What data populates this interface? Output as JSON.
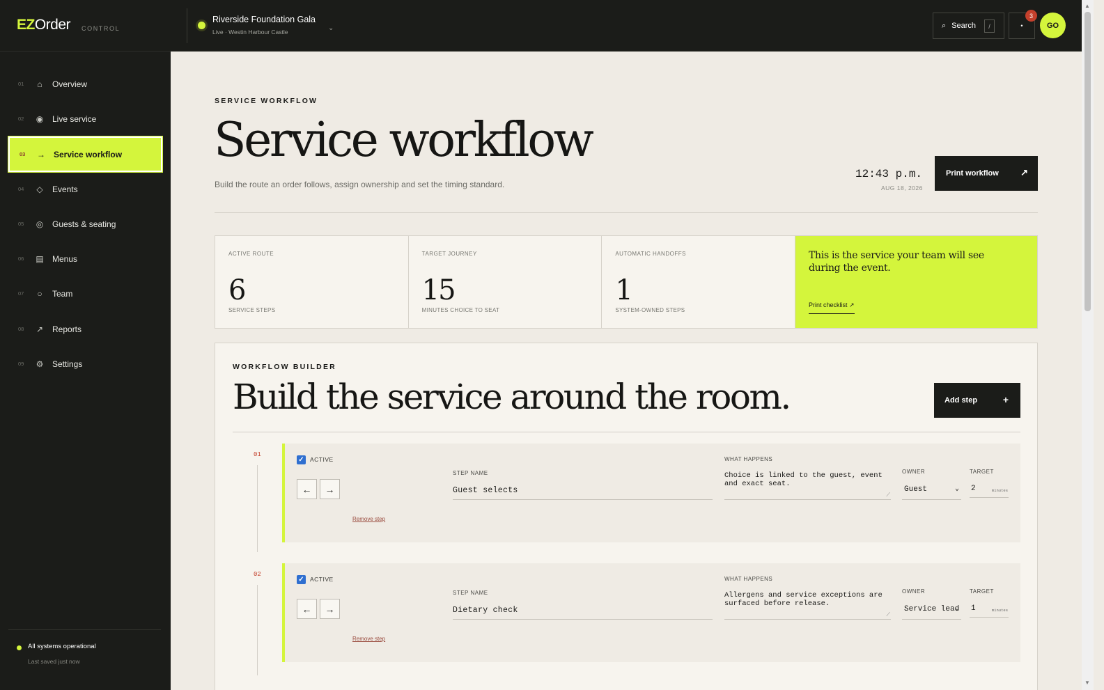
{
  "app": {
    "logo_ez": "EZ",
    "logo_order": "Order",
    "logo_sub": "CONTROL"
  },
  "event": {
    "name": "Riverside Foundation Gala",
    "sub": "Live · Westin Harbour Castle"
  },
  "header": {
    "search_label": "Search",
    "search_kbd": "/",
    "notif_dot": "•",
    "notif_count": "3",
    "avatar": "GO"
  },
  "sidebar": {
    "items": [
      {
        "num": "01",
        "icon": "⌂",
        "label": "Overview"
      },
      {
        "num": "02",
        "icon": "◉",
        "label": "Live service"
      },
      {
        "num": "03",
        "icon": "→",
        "label": "Service workflow"
      },
      {
        "num": "04",
        "icon": "◇",
        "label": "Events"
      },
      {
        "num": "05",
        "icon": "◎",
        "label": "Guests & seating"
      },
      {
        "num": "06",
        "icon": "▤",
        "label": "Menus"
      },
      {
        "num": "07",
        "icon": "○",
        "label": "Team"
      },
      {
        "num": "08",
        "icon": "↗",
        "label": "Reports"
      },
      {
        "num": "09",
        "icon": "⚙",
        "label": "Settings"
      }
    ],
    "status": "All systems operational",
    "saved": "Last saved just now"
  },
  "page": {
    "eyebrow": "SERVICE WORKFLOW",
    "title": "Service workflow",
    "subtitle": "Build the route an order follows, assign ownership and set the timing standard.",
    "time": "12:43 p.m.",
    "date": "AUG 18, 2026",
    "print_label": "Print workflow",
    "print_arrow": "↗"
  },
  "stats": [
    {
      "label": "ACTIVE ROUTE",
      "value": "6",
      "sub": "SERVICE STEPS"
    },
    {
      "label": "TARGET JOURNEY",
      "value": "15",
      "sub": "MINUTES CHOICE TO SEAT"
    },
    {
      "label": "AUTOMATIC HANDOFFS",
      "value": "1",
      "sub": "SYSTEM-OWNED STEPS"
    }
  ],
  "callout": {
    "text": "This is the service your team will see during the event.",
    "link": "Print checklist ↗"
  },
  "builder": {
    "eyebrow": "WORKFLOW BUILDER",
    "title": "Build the service around the room.",
    "add_label": "Add step",
    "add_icon": "+",
    "labels": {
      "active": "ACTIVE",
      "step_name": "STEP NAME",
      "what_happens": "WHAT HAPPENS",
      "owner": "OWNER",
      "target": "TARGET",
      "minutes": "minutes",
      "remove": "Remove step",
      "prev": "←",
      "next": "→",
      "check": "✓"
    },
    "steps": [
      {
        "num": "01",
        "name": "Guest selects",
        "what": "Choice is linked to the guest, event and exact seat.",
        "owner": "Guest",
        "target": "2"
      },
      {
        "num": "02",
        "name": "Dietary check",
        "what": "Allergens and service exceptions are surfaced before release.",
        "owner": "Service lead",
        "target": "1"
      }
    ]
  },
  "colors": {
    "accent": "#d4f53c",
    "dark": "#1b1c19",
    "canvas": "#efebe4",
    "danger": "#c4402c"
  }
}
